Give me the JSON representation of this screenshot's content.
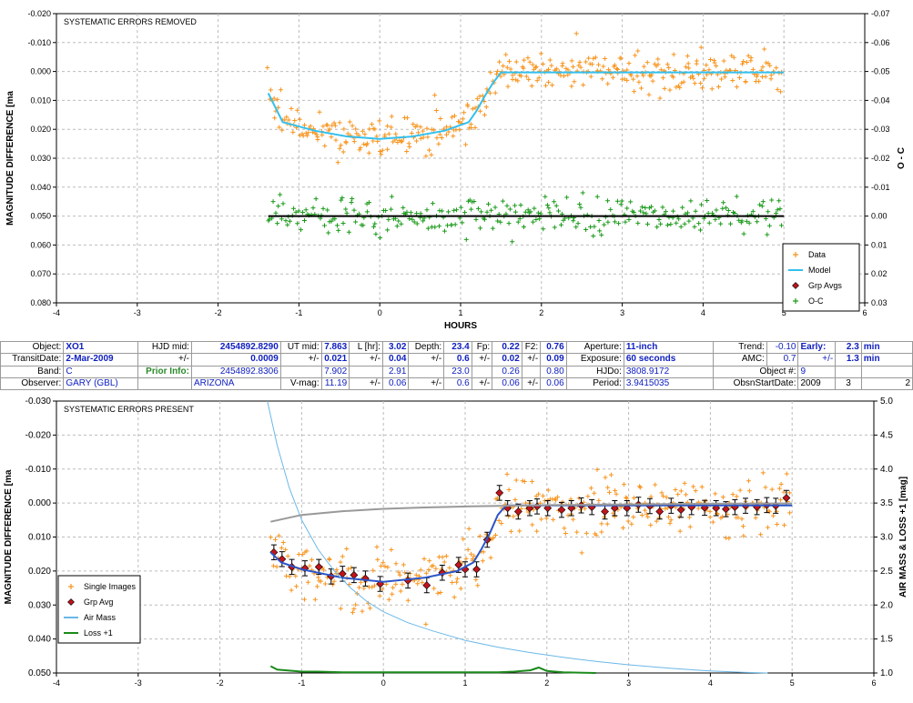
{
  "info": {
    "row1": {
      "object_label": "Object:",
      "object": "XO1",
      "hjd_mid_label": "HJD mid:",
      "hjd_mid": "2454892.8290",
      "ut_mid_label": "UT mid:",
      "ut_mid": "7.863",
      "length_label": "L [hr]:",
      "length": "3.02",
      "depth_label": "Depth:",
      "depth": "23.4",
      "fp_label": "Fp:",
      "fp": "0.22",
      "f2_label": "F2:",
      "f2": "0.76",
      "aperture_label": "Aperture:",
      "aperture": "11-inch",
      "trend_label": "Trend:",
      "trend": "-0.10",
      "early_label": "Early:",
      "early": "2.3",
      "early_unit": "min"
    },
    "row2": {
      "transit_label": "TransitDate:",
      "transit": "2-Mar-2009",
      "pm1": "+/-",
      "hjd_err": "0.0009",
      "pm2": "+/-",
      "ut_err": "0.021",
      "pm3": "+/-",
      "length_err": "0.04",
      "pm4": "+/-",
      "depth_err": "0.6",
      "pm5": "+/-",
      "fp_err": "0.02",
      "pm6": "+/-",
      "f2_err": "0.09",
      "exposure_label": "Exposure:",
      "exposure": "60 seconds",
      "amc_label": "AMC:",
      "amc": "0.7",
      "pm7": "+/-",
      "early_err": "1.3",
      "early_err_unit": "min"
    },
    "row3": {
      "band_label": "Band:",
      "band": "C",
      "prior_label": "Prior Info:",
      "prior_hjd": "2454892.8306",
      "prior_ut": "7.902",
      "prior_length": "2.91",
      "prior_depth": "23.0",
      "prior_fp": "0.26",
      "prior_f2": "0.80",
      "hjdo_label": "HJDo:",
      "hjdo": "3808.9172",
      "objnum_label": "Object #:",
      "objnum": "9"
    },
    "row4": {
      "observer_label": "Observer:",
      "observer": "GARY (GBL)",
      "location": "ARIZONA",
      "vmag_label": "V-mag:",
      "vmag": "11.19",
      "pm1": "+/-",
      "vmag_err": "0.06",
      "pm2": "+/-",
      "v2": "0.6",
      "pm3": "+/-",
      "v3": "0.06",
      "pm4": "+/-",
      "v4": "0.06",
      "period_label": "Period:",
      "period": "3.9415035",
      "obsn_label": "ObsnStartDate:",
      "obs_year": "2009",
      "obs_month": "3",
      "obs_day": "2"
    }
  },
  "chart_data": [
    {
      "type": "scatter",
      "title": "SYSTEMATIC ERRORS REMOVED",
      "xlabel": "HOURS",
      "ylabel": "MAGNITUDE DIFFERENCE [ma",
      "y2label": "O - C",
      "xlim": [
        -4,
        6
      ],
      "ylim": [
        -0.02,
        0.08
      ],
      "y_inverted": true,
      "y2lim": [
        -0.07,
        0.03
      ],
      "grid": true,
      "legend_position": "bottom-right",
      "xticks": [
        "-4",
        "-3",
        "-2",
        "-1",
        "0",
        "1",
        "2",
        "3",
        "4",
        "5",
        "6"
      ],
      "yticks": [
        "-0.020",
        "-0.010",
        "0.000",
        "0.010",
        "0.020",
        "0.030",
        "0.040",
        "0.050",
        "0.060",
        "0.070",
        "0.080"
      ],
      "y2ticks": [
        "-0.07",
        "-0.06",
        "-0.05",
        "-0.04",
        "-0.03",
        "-0.02",
        "-0.01",
        "0.00",
        "0.01",
        "0.02",
        "0.03"
      ],
      "series": [
        {
          "name": "Data",
          "color": "#f7941d",
          "marker": "plus",
          "model": "transit",
          "noise": 0.0032,
          "x_range": [
            -1.38,
            4.98
          ],
          "count": 400
        },
        {
          "name": "Model",
          "color": "#33c0ee",
          "line": true,
          "x": [
            -1.38,
            -1.2,
            -0.8,
            -0.4,
            0.0,
            0.4,
            0.8,
            1.1,
            1.2,
            1.3,
            1.4,
            1.5,
            5.0
          ],
          "values": [
            0.0075,
            0.0175,
            0.0205,
            0.0225,
            0.0233,
            0.0225,
            0.0205,
            0.0175,
            0.0135,
            0.0085,
            0.004,
            0.0003,
            0.0003
          ]
        },
        {
          "name": "Grp Avgs",
          "color": "#c0141c",
          "marker": "diamond"
        },
        {
          "name": "O-C",
          "color": "#1a9a1a",
          "marker": "plus",
          "model": "constant",
          "level": 0.05,
          "noise": 0.0032,
          "x_range": [
            -1.38,
            4.98
          ],
          "count": 300
        },
        {
          "name": "",
          "color": "#000000",
          "line": true,
          "x": [
            -1.38,
            5.0
          ],
          "values": [
            0.05,
            0.05
          ]
        }
      ]
    },
    {
      "type": "scatter",
      "title": "SYSTEMATIC ERRORS PRESENT",
      "xlabel": "",
      "ylabel": "MAGNITUDE DIFFERENCE [ma",
      "y2label": "AIR MASS & LOSS +1 [mag]",
      "xlim": [
        -4,
        6
      ],
      "ylim": [
        -0.03,
        0.05
      ],
      "y_inverted": true,
      "y2lim": [
        1.0,
        5.0
      ],
      "grid": true,
      "legend_position": "bottom-left",
      "xticks": [
        "-4",
        "-3",
        "-2",
        "-1",
        "0",
        "1",
        "2",
        "3",
        "4",
        "5",
        "6"
      ],
      "yticks": [
        "-0.030",
        "-0.020",
        "-0.010",
        "0.000",
        "0.010",
        "0.020",
        "0.030",
        "0.040",
        "0.050"
      ],
      "y2ticks": [
        "1.0",
        "1.5",
        "2.0",
        "2.5",
        "3.0",
        "3.5",
        "4.0",
        "4.5",
        "5.0"
      ],
      "series": [
        {
          "name": "Single Images",
          "color": "#f7941d",
          "marker": "plus",
          "model": "transit",
          "noise": 0.0045,
          "x_range": [
            -1.38,
            4.98
          ],
          "count": 360
        },
        {
          "name": "Grp Avg",
          "color": "#c0141c",
          "marker": "diamond",
          "error": 0.0022,
          "x": [
            -1.34,
            -1.24,
            -1.12,
            -0.96,
            -0.79,
            -0.64,
            -0.5,
            -0.36,
            -0.22,
            -0.04,
            0.3,
            0.53,
            0.72,
            0.92,
            1.0,
            1.14,
            1.27,
            1.42,
            1.52,
            1.65,
            1.79,
            1.88,
            2.01,
            2.18,
            2.3,
            2.42,
            2.55,
            2.71,
            2.83,
            2.98,
            3.12,
            3.26,
            3.38,
            3.52,
            3.64,
            3.77,
            3.93,
            4.07,
            4.19,
            4.3,
            4.43,
            4.57,
            4.69,
            4.8,
            4.93
          ],
          "values": [
            0.0145,
            0.0165,
            0.0188,
            0.0192,
            0.0188,
            0.0216,
            0.0208,
            0.0212,
            0.0222,
            0.0238,
            0.0228,
            0.0242,
            0.0205,
            0.0182,
            0.0195,
            0.0195,
            0.0108,
            -0.003,
            0.0015,
            0.0025,
            0.0015,
            0.001,
            0.0015,
            0.002,
            0.0015,
            0.0007,
            0.0012,
            0.0025,
            0.0015,
            0.0015,
            0.0005,
            0.0009,
            0.0025,
            0.0008,
            0.002,
            0.0012,
            0.0014,
            0.0015,
            0.0018,
            0.0012,
            0.0008,
            0.0012,
            0.0006,
            0.0008,
            -0.0015
          ]
        },
        {
          "name": "",
          "color": "#2b55c8",
          "line": true,
          "x": [
            -1.38,
            -1.25,
            -1.0,
            -0.5,
            0.0,
            0.5,
            0.9,
            1.1,
            1.2,
            1.3,
            1.4,
            1.5,
            1.6,
            5.0
          ],
          "values": [
            0.0145,
            0.0175,
            0.0195,
            0.022,
            0.0232,
            0.022,
            0.02,
            0.0175,
            0.0135,
            0.009,
            0.0035,
            0.0007,
            0.0007,
            0.0007
          ]
        },
        {
          "name": "Air Mass",
          "color": "#6ab8e8",
          "line": true,
          "x": [
            -1.42,
            -1.3,
            -1.15,
            -1.0,
            -0.8,
            -0.6,
            -0.4,
            -0.2,
            0.0,
            0.3,
            0.6,
            1.0,
            1.4,
            1.8,
            2.2,
            2.6,
            3.0,
            3.5,
            4.0,
            4.4,
            4.7
          ],
          "values": [
            5.0,
            4.35,
            3.72,
            3.25,
            2.82,
            2.5,
            2.25,
            2.05,
            1.9,
            1.74,
            1.62,
            1.48,
            1.38,
            1.3,
            1.23,
            1.17,
            1.12,
            1.07,
            1.03,
            1.01,
            1.0
          ]
        },
        {
          "name": "Loss +1",
          "color": "#1a8a1a",
          "line": true,
          "x": [
            -1.38,
            -1.3,
            -1.2,
            -1.1,
            -1.0,
            -0.8,
            -0.5,
            0.0,
            0.5,
            1.0,
            1.4,
            1.6,
            1.8,
            1.9,
            2.0,
            2.2,
            2.6
          ],
          "values": [
            1.1,
            1.05,
            1.04,
            1.03,
            1.02,
            1.02,
            1.01,
            1.01,
            1.01,
            1.01,
            1.01,
            1.02,
            1.04,
            1.08,
            1.03,
            1.01,
            1.0
          ]
        },
        {
          "name": "",
          "color": "#999999",
          "line": true,
          "x": [
            -1.38,
            -1.0,
            -0.5,
            0.0,
            0.5,
            1.0,
            1.5,
            2.0,
            3.0,
            4.0,
            5.0
          ],
          "values": [
            0.0055,
            0.0035,
            0.0024,
            0.0017,
            0.0013,
            0.001,
            0.0008,
            0.0006,
            0.0004,
            0.0002,
            0.0001
          ]
        }
      ]
    }
  ]
}
